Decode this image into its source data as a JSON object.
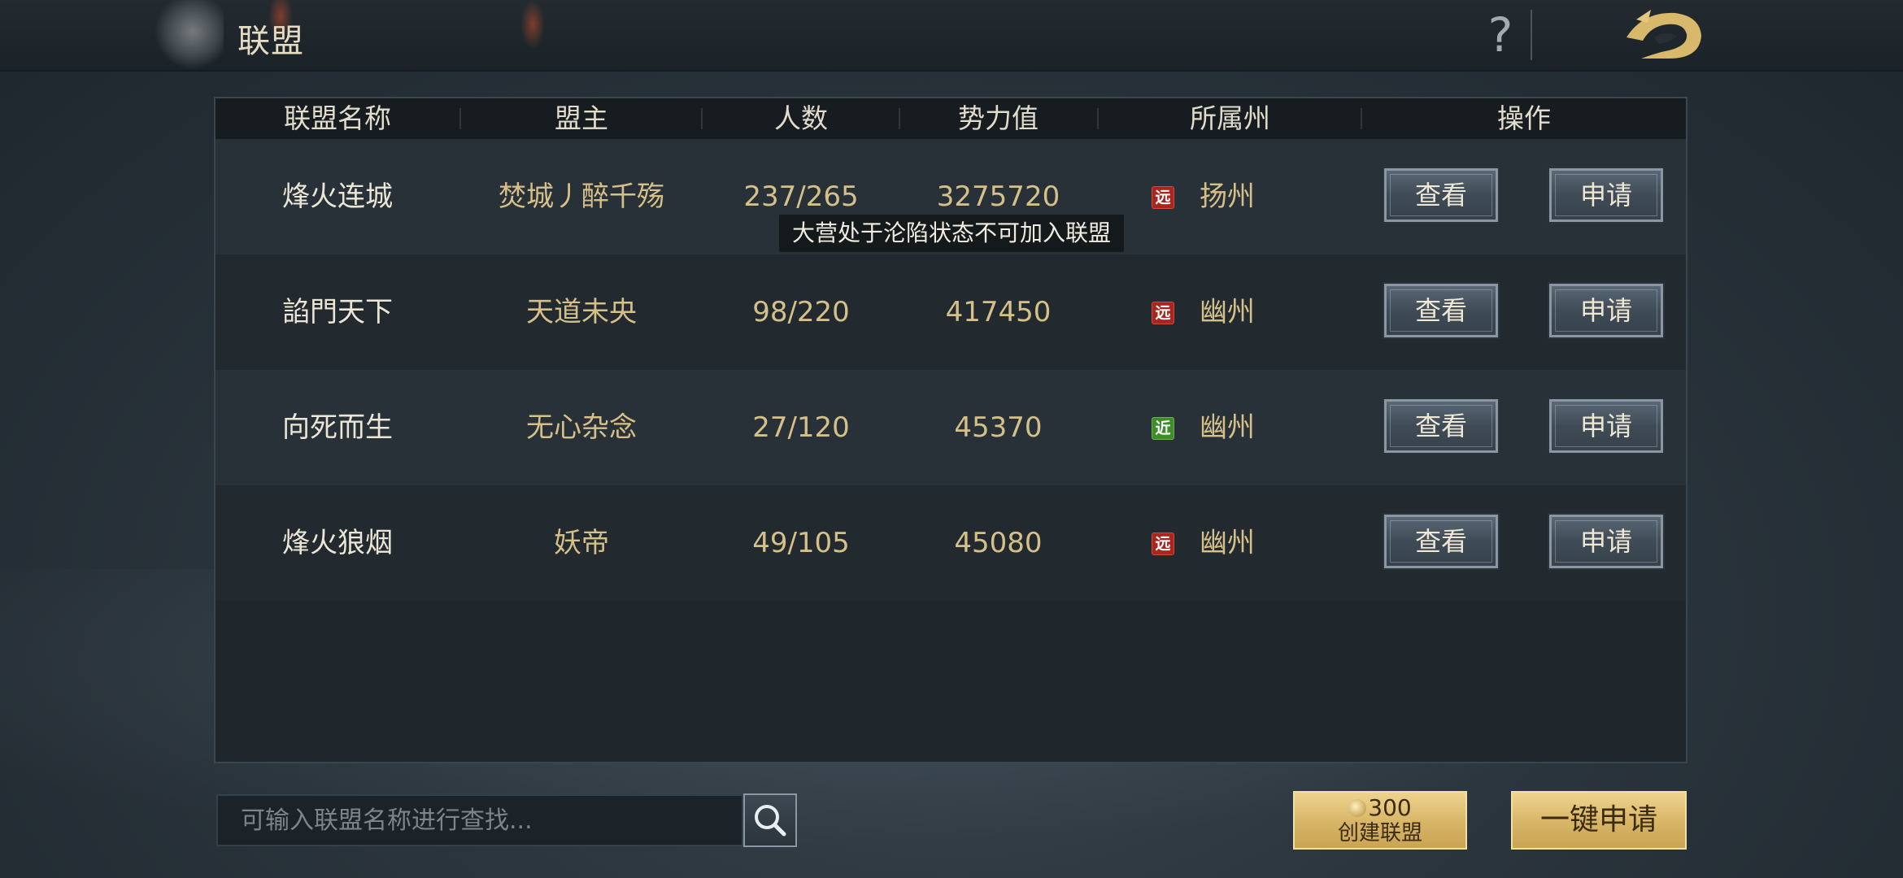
{
  "header": {
    "title": "联盟",
    "help_label": "?"
  },
  "table": {
    "columns": [
      "联盟名称",
      "盟主",
      "人数",
      "势力值",
      "所属州",
      "操作"
    ],
    "rows": [
      {
        "name": "烽火连城",
        "leader": "焚城丿醉千殇",
        "members": "237/265",
        "power": "3275720",
        "distance": "远",
        "state": "扬州",
        "view": "查看",
        "apply": "申请"
      },
      {
        "name": "諂門天下",
        "leader": "天道未央",
        "members": "98/220",
        "power": "417450",
        "distance": "远",
        "state": "幽州",
        "view": "查看",
        "apply": "申请"
      },
      {
        "name": "向死而生",
        "leader": "无心杂念",
        "members": "27/120",
        "power": "45370",
        "distance": "近",
        "state": "幽州",
        "view": "查看",
        "apply": "申请"
      },
      {
        "name": "烽火狼烟",
        "leader": "妖帝",
        "members": "49/105",
        "power": "45080",
        "distance": "远",
        "state": "幽州",
        "view": "查看",
        "apply": "申请"
      }
    ]
  },
  "tooltip": "大营处于沦陷状态不可加入联盟",
  "search": {
    "placeholder": "可输入联盟名称进行查找...",
    "value": ""
  },
  "create_alliance": {
    "cost": "300",
    "label": "创建联盟"
  },
  "one_key_apply_label": "一键申请",
  "colors": {
    "gold_text": "#d6c08a",
    "far_badge": "#a8261e",
    "near_badge": "#3f8c2c",
    "gold_button": "#d7b567"
  }
}
